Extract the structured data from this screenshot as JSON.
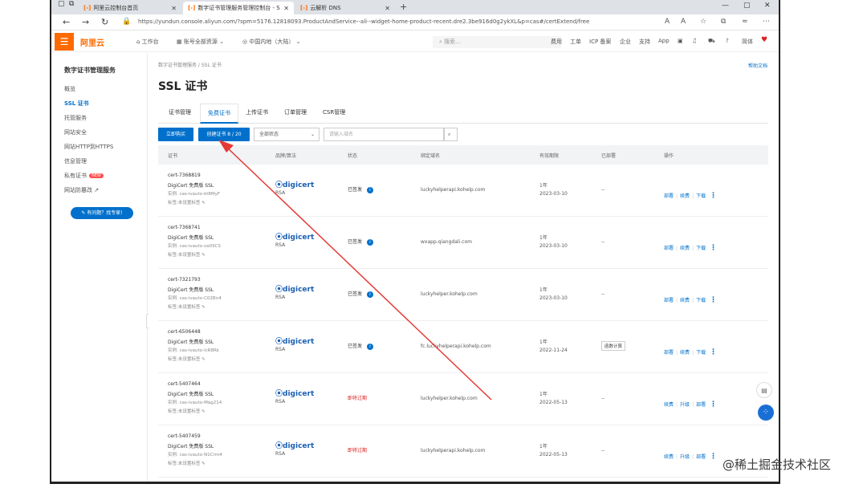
{
  "browser": {
    "tabs": [
      {
        "label": "阿里云控制台首页",
        "favicon": "[-]",
        "active": false
      },
      {
        "label": "数字证书管理服务管理控制台 - S",
        "favicon": "[-]",
        "active": true
      },
      {
        "label": "云解析 DNS",
        "favicon": "[-]",
        "active": false
      }
    ],
    "url": "https://yundun.console.aliyun.com/?spm=5176.12818093.ProductAndService--ali--widget-home-product-recent.dre2.3be916d0g2ykXL&p=cas#/certExtend/free",
    "reader_icon": "A",
    "zoom_icon": "A"
  },
  "topbar": {
    "logo": "阿里云",
    "workbench": "工作台",
    "account_scope": "账号全部资源",
    "region": "中国内地（大陆）",
    "search_placeholder": "搜索...",
    "links": [
      "费用",
      "工单",
      "ICP 备案",
      "企业",
      "支持",
      "App"
    ],
    "lang": "简体"
  },
  "sidebar": {
    "title": "数字证书管理服务",
    "items": [
      {
        "label": "概览"
      },
      {
        "label": "SSL 证书",
        "active": true
      },
      {
        "label": "托管服务"
      },
      {
        "label": "网站安全"
      },
      {
        "label": "网站HTTP到HTTPS"
      },
      {
        "label": "信息管理"
      },
      {
        "label": "私有证书",
        "badge": "NEW"
      },
      {
        "label": "网站防篡改"
      }
    ],
    "help_pill": "有问题？找专家!"
  },
  "main": {
    "breadcrumb": "数字证书管理服务 / SSL 证书",
    "help_doc": "帮助文档",
    "title": "SSL 证书",
    "tabs": [
      "证书管理",
      "免费证书",
      "上传证书",
      "订单管理",
      "CSR管理"
    ],
    "buy_button": "立即购买",
    "create_button": "创建证书 8 / 20",
    "status_filter": "全部状态",
    "domain_search_placeholder": "请输入域名",
    "columns": [
      "证书",
      "品牌/算法",
      "状态",
      "绑定域名",
      "有效期限",
      "已部署",
      "操作"
    ]
  },
  "certs": [
    {
      "id": "cert-7368819",
      "name": "DigiCert 免费版 SSL",
      "instance": "实例: cas-ivauto-kt8MyF",
      "tag": "标签:未设置标签",
      "brand": "digicert",
      "algo": "RSA",
      "status": "已签发",
      "status_info": "i",
      "domain": "luckyhelperapi.kohelp.com",
      "period": "1年",
      "expiry": "2023-03-10",
      "deployed": "--",
      "fee": "",
      "actions": [
        "部署",
        "续费",
        "下载"
      ]
    },
    {
      "id": "cert-7368741",
      "name": "DigiCert 免费版 SSL",
      "instance": "实例: cas-ivauto-va0SCS",
      "tag": "标签:未设置标签",
      "brand": "digicert",
      "algo": "RSA",
      "status": "已签发",
      "status_info": "i",
      "domain": "wxapp.qiangdali.com",
      "period": "1年",
      "expiry": "2023-03-10",
      "deployed": "--",
      "fee": "",
      "actions": [
        "部署",
        "续费",
        "下载"
      ]
    },
    {
      "id": "cert-7321793",
      "name": "DigiCert 免费版 SSL",
      "instance": "实例: cas-ivauto-C02Bn4",
      "tag": "标签:未设置标签",
      "brand": "digicert",
      "algo": "RSA",
      "status": "已签发",
      "status_info": "i",
      "domain": "luckyhelper.kohelp.com",
      "period": "1年",
      "expiry": "2023-03-10",
      "deployed": "--",
      "fee": "",
      "actions": [
        "部署",
        "续费",
        "下载"
      ]
    },
    {
      "id": "cert-6506448",
      "name": "DigiCert 免费版 SSL",
      "instance": "实例: cas-ivauto-lcR8Rk",
      "tag": "标签:未设置标签",
      "brand": "digicert",
      "algo": "RSA",
      "status": "已签发",
      "status_info": "i",
      "domain": "fc.luckyhelperapi.kohelp.com",
      "period": "1年",
      "expiry": "2022-11-24",
      "deployed": "",
      "fee": "函数计算",
      "actions": [
        "部署",
        "续费",
        "下载"
      ]
    },
    {
      "id": "cert-5407464",
      "name": "DigiCert 免费版 SSL",
      "instance": "实例: cas-ivauto-Mag214",
      "tag": "标签:未设置标签",
      "brand": "digicert",
      "algo": "RSA",
      "status": "即将过期",
      "status_info": "",
      "domain": "luckyhelper.kohelp.com",
      "period": "1年",
      "expiry": "2022-05-13",
      "deployed": "--",
      "fee": "",
      "actions": [
        "续费",
        "升级",
        "部署"
      ]
    },
    {
      "id": "cert-5407459",
      "name": "DigiCert 免费版 SSL",
      "instance": "实例: cas-ivauto-N1Crm4",
      "tag": "标签:未设置标签",
      "brand": "digicert",
      "algo": "RSA",
      "status": "即将过期",
      "status_info": "",
      "domain": "luckyhelperapi.kohelp.com",
      "period": "1年",
      "expiry": "2022-05-13",
      "deployed": "--",
      "fee": "",
      "actions": [
        "续费",
        "升级",
        "部署"
      ]
    }
  ],
  "watermark": "@稀土掘金技术社区",
  "colors": {
    "accent": "#0070cc",
    "brand": "#ff6a00",
    "warn": "#e02020",
    "arrow": "#e53935"
  }
}
